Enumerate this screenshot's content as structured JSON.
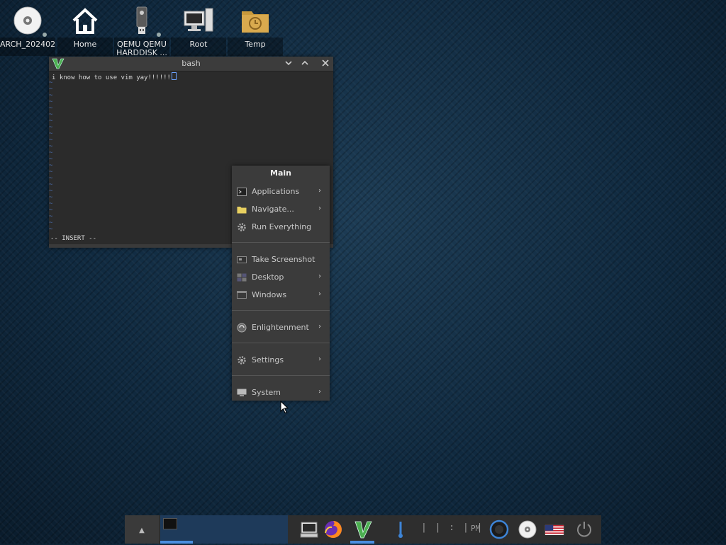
{
  "desktop_icons": [
    {
      "name": "arch-disc",
      "label": "ARCH_202402"
    },
    {
      "name": "home",
      "label": "Home"
    },
    {
      "name": "qemu-harddisk",
      "label": "QEMU QEMU HARDDISK ..."
    },
    {
      "name": "root",
      "label": "Root"
    },
    {
      "name": "temp",
      "label": "Temp"
    }
  ],
  "terminal": {
    "title": "bash",
    "text": "i know how to use vim yay!!!!!!",
    "tilde": "~",
    "mode": "-- INSERT --"
  },
  "menu": {
    "title": "Main",
    "items": [
      {
        "label": "Applications",
        "icon": "terminal-icon",
        "submenu": true
      },
      {
        "label": "Navigate...",
        "icon": "folder-icon",
        "submenu": true
      },
      {
        "label": "Run Everything",
        "icon": "gear-icon",
        "submenu": false
      },
      {
        "label": "Take Screenshot",
        "icon": "screenshot-icon",
        "submenu": false
      },
      {
        "label": "Desktop",
        "icon": "desktop-icon",
        "submenu": true
      },
      {
        "label": "Windows",
        "icon": "windows-icon",
        "submenu": true
      },
      {
        "label": "Enlightenment",
        "icon": "enlightenment-icon",
        "submenu": true
      },
      {
        "label": "Settings",
        "icon": "gear-icon",
        "submenu": true
      },
      {
        "label": "System",
        "icon": "monitor-icon",
        "submenu": true
      }
    ],
    "arrow": "›"
  },
  "taskbar": {
    "up_arrow": "▲",
    "clock": "| | : | |",
    "ampm": "PM"
  },
  "colors": {
    "accent": "#4b8fe0",
    "menu_bg": "#3b3b3b",
    "terminal_bg": "#2b2b2b"
  }
}
